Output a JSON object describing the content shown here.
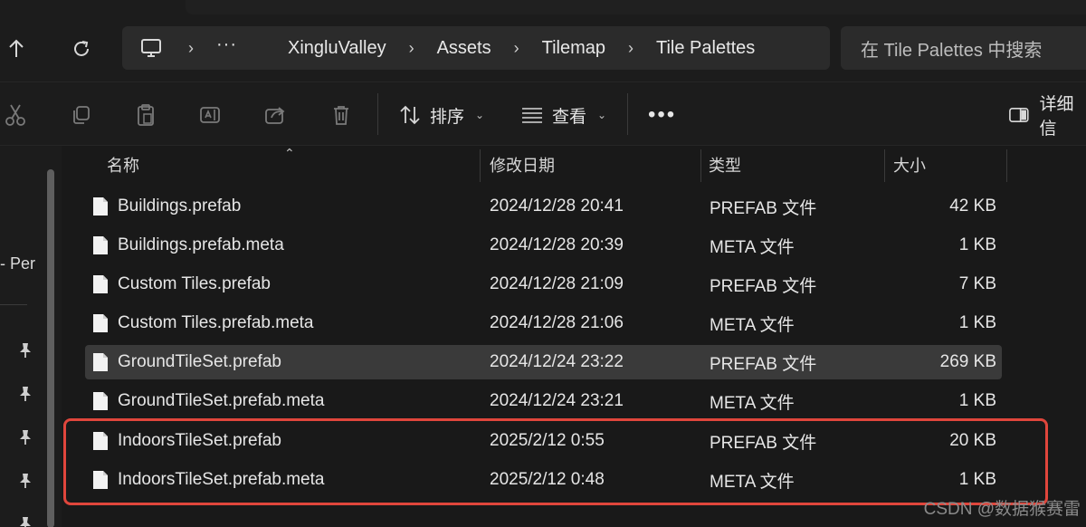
{
  "nav": {
    "breadcrumb": [
      "XingluValley",
      "Assets",
      "Tilemap",
      "Tile Palettes"
    ],
    "more": "···",
    "search_placeholder": "在 Tile Palettes 中搜索"
  },
  "toolbar": {
    "sort_label": "排序",
    "view_label": "查看",
    "more": "•••",
    "details_label": "详细信"
  },
  "sidebar": {
    "partial_label": "- Per"
  },
  "columns": {
    "name": "名称",
    "date": "修改日期",
    "type": "类型",
    "size": "大小"
  },
  "files": [
    {
      "name": "Buildings.prefab",
      "date": "2024/12/28 20:41",
      "type": "PREFAB 文件",
      "size": "42 KB"
    },
    {
      "name": "Buildings.prefab.meta",
      "date": "2024/12/28 20:39",
      "type": "META 文件",
      "size": "1 KB"
    },
    {
      "name": "Custom Tiles.prefab",
      "date": "2024/12/28 21:09",
      "type": "PREFAB 文件",
      "size": "7 KB"
    },
    {
      "name": "Custom Tiles.prefab.meta",
      "date": "2024/12/28 21:06",
      "type": "META 文件",
      "size": "1 KB"
    },
    {
      "name": "GroundTileSet.prefab",
      "date": "2024/12/24 23:22",
      "type": "PREFAB 文件",
      "size": "269 KB"
    },
    {
      "name": "GroundTileSet.prefab.meta",
      "date": "2024/12/24 23:21",
      "type": "META 文件",
      "size": "1 KB"
    },
    {
      "name": "IndoorsTileSet.prefab",
      "date": "2025/2/12 0:55",
      "type": "PREFAB 文件",
      "size": "20 KB"
    },
    {
      "name": "IndoorsTileSet.prefab.meta",
      "date": "2025/2/12 0:48",
      "type": "META 文件",
      "size": "1 KB"
    }
  ],
  "colors": {
    "background": "#191919",
    "selected_row": "#3a3a3a",
    "highlight_box": "#e0463c"
  },
  "watermark": "CSDN @数据猴赛雷"
}
